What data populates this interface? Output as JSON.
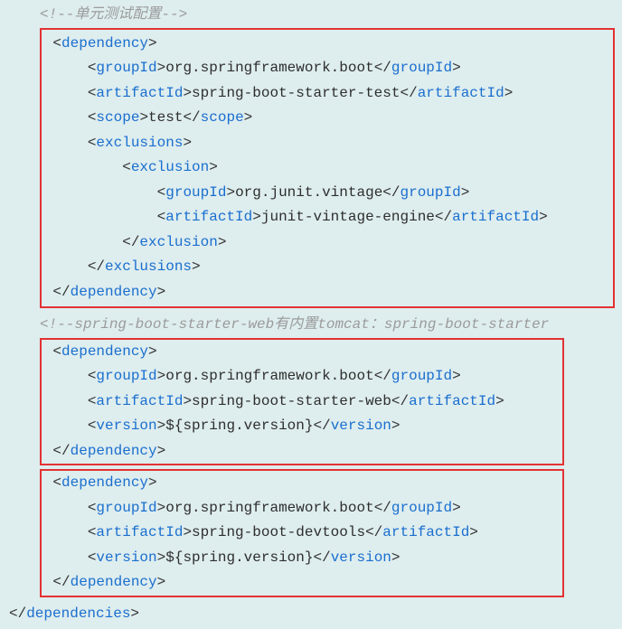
{
  "comment1": "<!--单元测试配置-->",
  "comment2": "<!--spring-boot-starter-web有内置tomcat：spring-boot-starter",
  "tags": {
    "dependency_open": "dependency",
    "dependency_close": "dependency",
    "groupId_open": "groupId",
    "groupId_close": "groupId",
    "artifactId_open": "artifactId",
    "artifactId_close": "artifactId",
    "scope_open": "scope",
    "scope_close": "scope",
    "exclusions_open": "exclusions",
    "exclusions_close": "exclusions",
    "exclusion_open": "exclusion",
    "exclusion_close": "exclusion",
    "version_open": "version",
    "version_close": "version",
    "dependencies_close": "dependencies"
  },
  "dep1": {
    "groupId": "org.springframework.boot",
    "artifactId": "spring-boot-starter-test",
    "scope": "test",
    "excl_groupId": "org.junit.vintage",
    "excl_artifactId": "junit-vintage-engine"
  },
  "dep2": {
    "groupId": "org.springframework.boot",
    "artifactId": "spring-boot-starter-web",
    "version": "${spring.version}"
  },
  "dep3": {
    "groupId": "org.springframework.boot",
    "artifactId": "spring-boot-devtools",
    "version": "${spring.version}"
  }
}
